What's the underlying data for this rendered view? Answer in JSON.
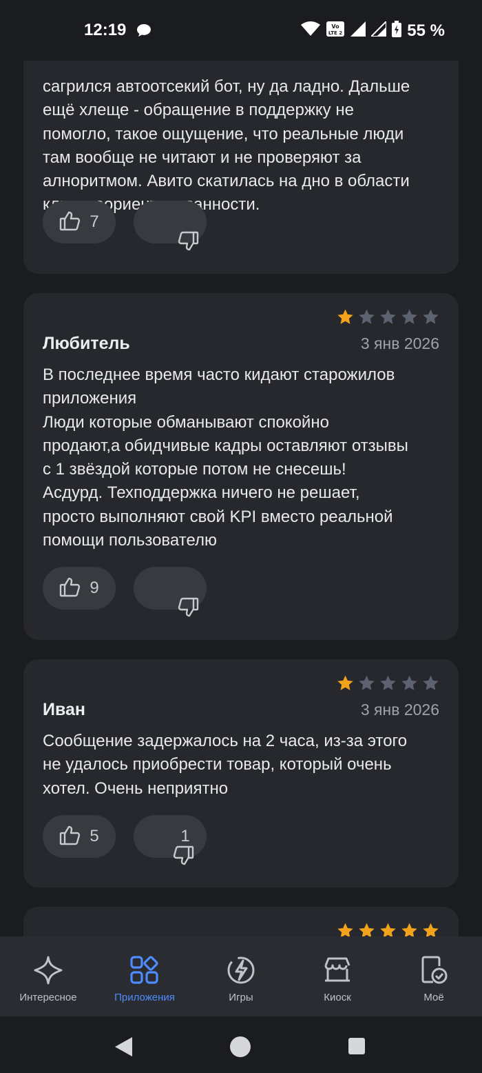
{
  "status_bar": {
    "time": "12:19",
    "battery": "55 %",
    "icons": [
      "chat-icon",
      "wifi-icon",
      "volte-icon",
      "signal-icon",
      "signal-icon",
      "battery-icon"
    ]
  },
  "reviews": [
    {
      "partial": true,
      "text_lines": [
        "сагрился автоотсекий бот, ну да ладно. Дальше",
        "ещё хлеще - обращение в поддержку не",
        "помогло, такое ощущение, что реальные люди",
        "там вообще не читают и не проверяют за",
        "алноритмом. Авито скатилась на дно в области",
        "клиентоориентированности."
      ],
      "likes": "7",
      "dislikes": ""
    },
    {
      "author": "Любитель",
      "date": "3 янв 2026",
      "rating": 1,
      "text_lines": [
        "В последнее время часто кидают старожилов",
        "приложения",
        "Люди которые обманывают спокойно",
        "продают,а обидчивые кадры оставляют отзывы",
        "с 1 звёздой которые потом не снесешь!",
        "Асдурд. Техподдержка ничего не решает,",
        "просто выполняют свой KPI вместо реальной",
        "помощи пользователю"
      ],
      "likes": "9",
      "dislikes": ""
    },
    {
      "author": "Иван",
      "date": "3 янв 2026",
      "rating": 1,
      "text_lines": [
        "Сообщение задержалось на 2 часа, из-за этого",
        "не удалось приобрести товар, который очень",
        "хотел. Очень неприятно"
      ],
      "likes": "5",
      "dislikes": "1"
    },
    {
      "partial": true,
      "rating": 5
    }
  ],
  "bottom_nav": [
    {
      "label": "Интересное",
      "icon": "sparkle-icon",
      "active": false
    },
    {
      "label": "Приложения",
      "icon": "apps-grid-icon",
      "active": true
    },
    {
      "label": "Игры",
      "icon": "games-icon",
      "active": false
    },
    {
      "label": "Киоск",
      "icon": "kiosk-store-icon",
      "active": false
    },
    {
      "label": "Моё",
      "icon": "my-apps-icon",
      "active": false
    }
  ],
  "colors": {
    "background": "#1b1c20",
    "card": "#26282d",
    "vote_button": "#383a40",
    "star_filled": "#f2a21b",
    "star_empty": "#5c6270",
    "accent": "#4d8dff"
  }
}
